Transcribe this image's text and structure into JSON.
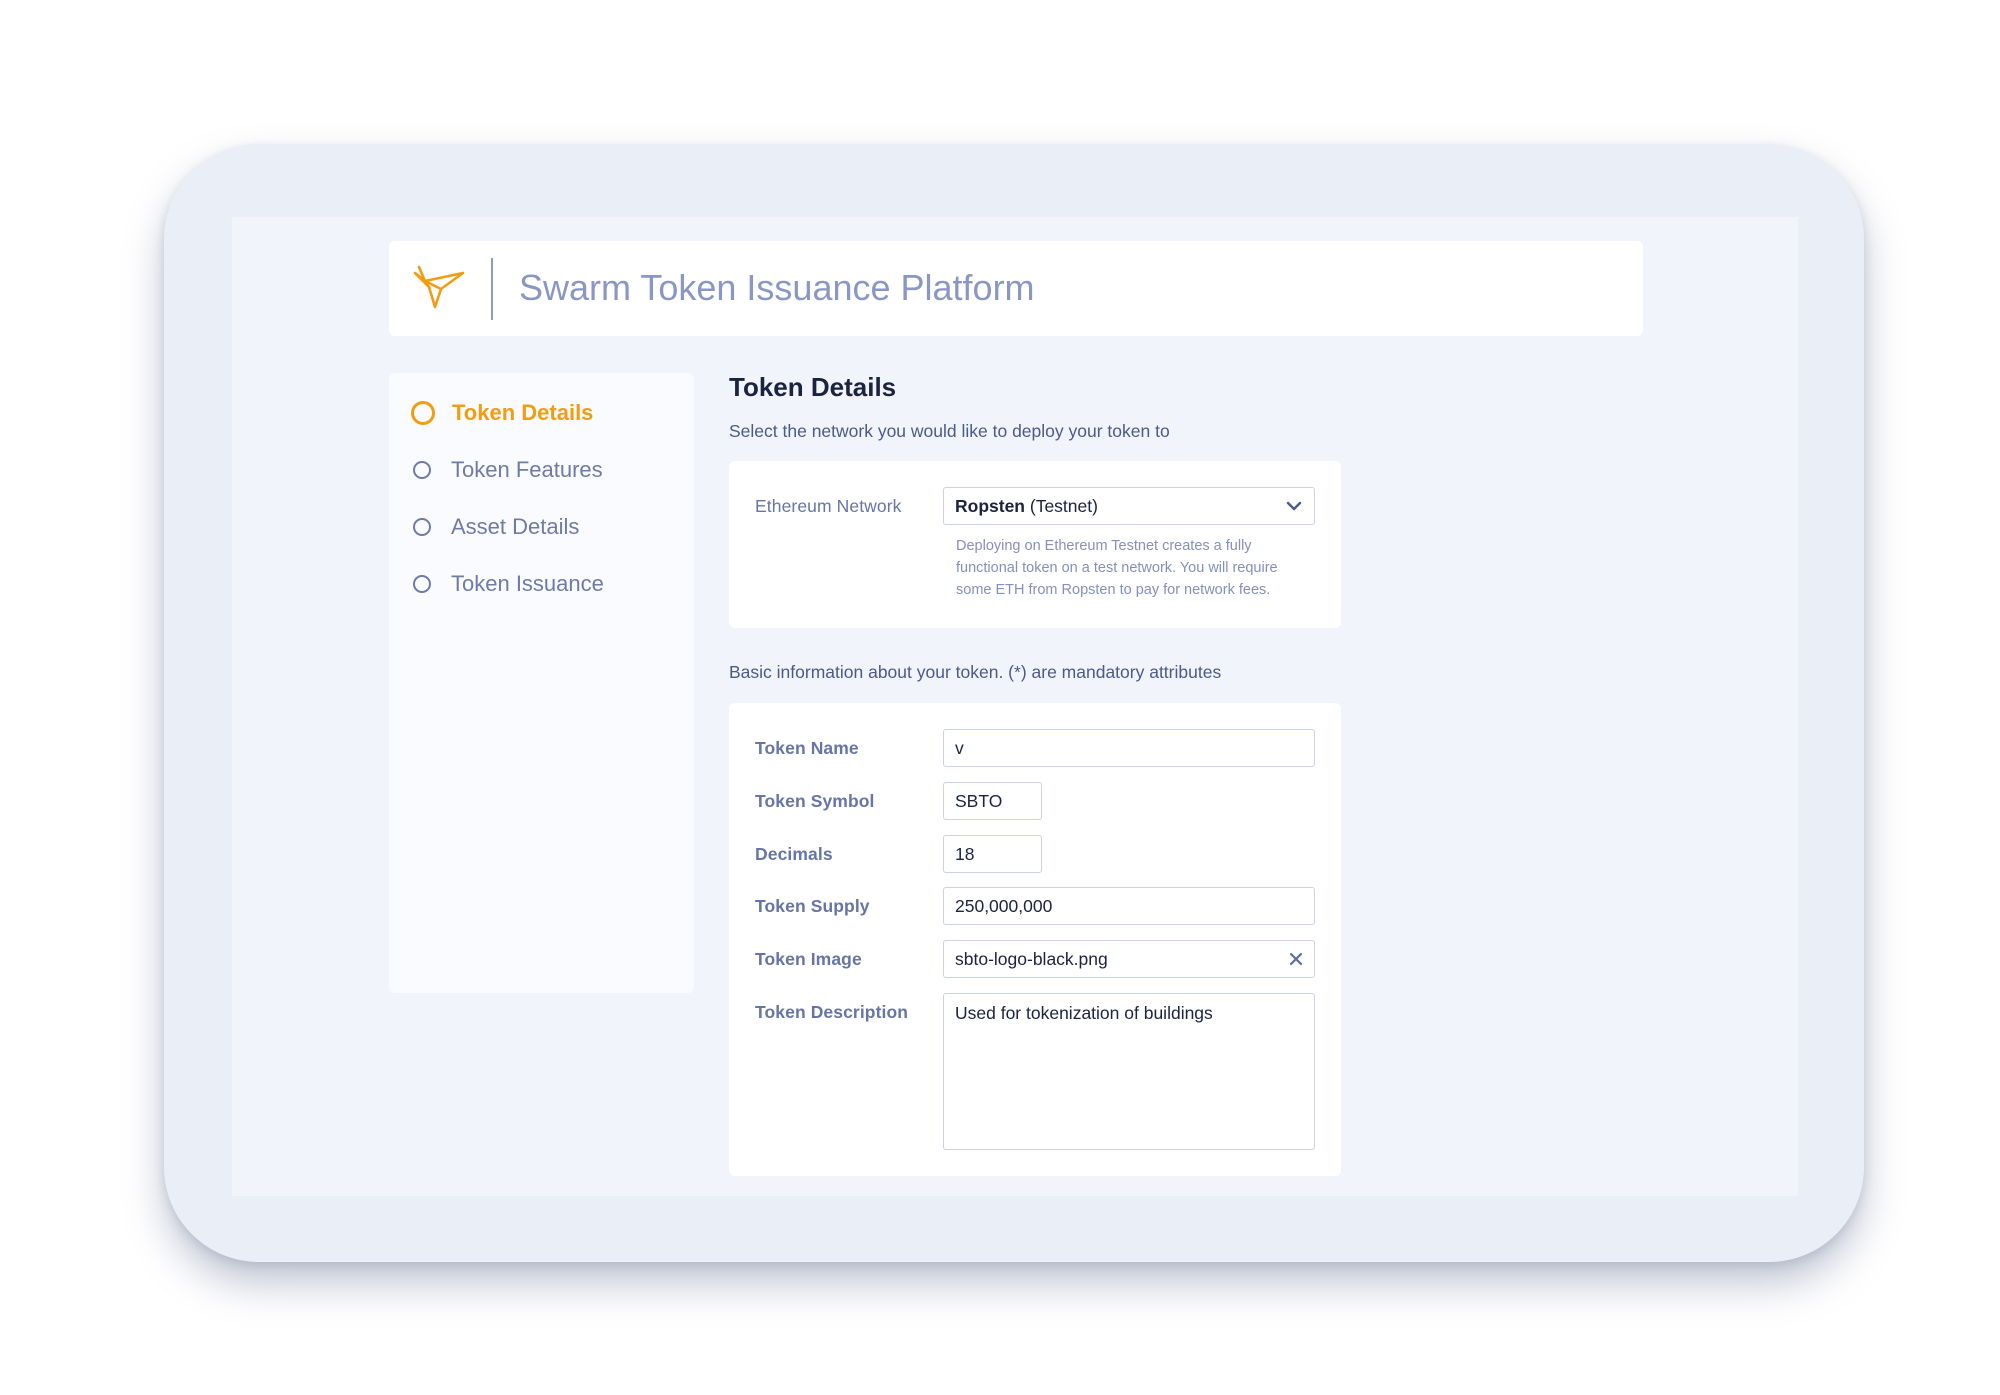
{
  "header": {
    "logo_icon": "swarm-bird-icon",
    "title": "Swarm Token Issuance Platform"
  },
  "sidebar": {
    "steps": [
      {
        "label": "Token Details",
        "active": true
      },
      {
        "label": "Token Features",
        "active": false
      },
      {
        "label": "Asset Details",
        "active": false
      },
      {
        "label": "Token Issuance",
        "active": false
      }
    ]
  },
  "main": {
    "title": "Token Details",
    "network_prompt": "Select the network you would like to deploy your token to",
    "network": {
      "label": "Ethereum Network",
      "selected_bold": "Ropsten",
      "selected_rest": " (Testnet)",
      "hint": "Deploying on Ethereum Testnet creates a fully functional token on a test network. You will require some ETH from Ropsten to pay for network fees."
    },
    "basic_prompt": "Basic information about your token. (*) are mandatory attributes",
    "fields": {
      "token_name": {
        "label": "Token Name",
        "value": "v"
      },
      "token_symbol": {
        "label": "Token Symbol",
        "value": "SBTO"
      },
      "decimals": {
        "label": "Decimals",
        "value": "18"
      },
      "token_supply": {
        "label": "Token Supply",
        "value": "250,000,000"
      },
      "token_image": {
        "label": "Token Image",
        "value": "sbto-logo-black.png"
      },
      "token_description": {
        "label": "Token Description",
        "value": "Used for tokenization of buildings"
      }
    }
  },
  "colors": {
    "accent": "#f39c12",
    "label": "#6774a6",
    "text": "#1a2340",
    "background": "#f1f4fb"
  }
}
